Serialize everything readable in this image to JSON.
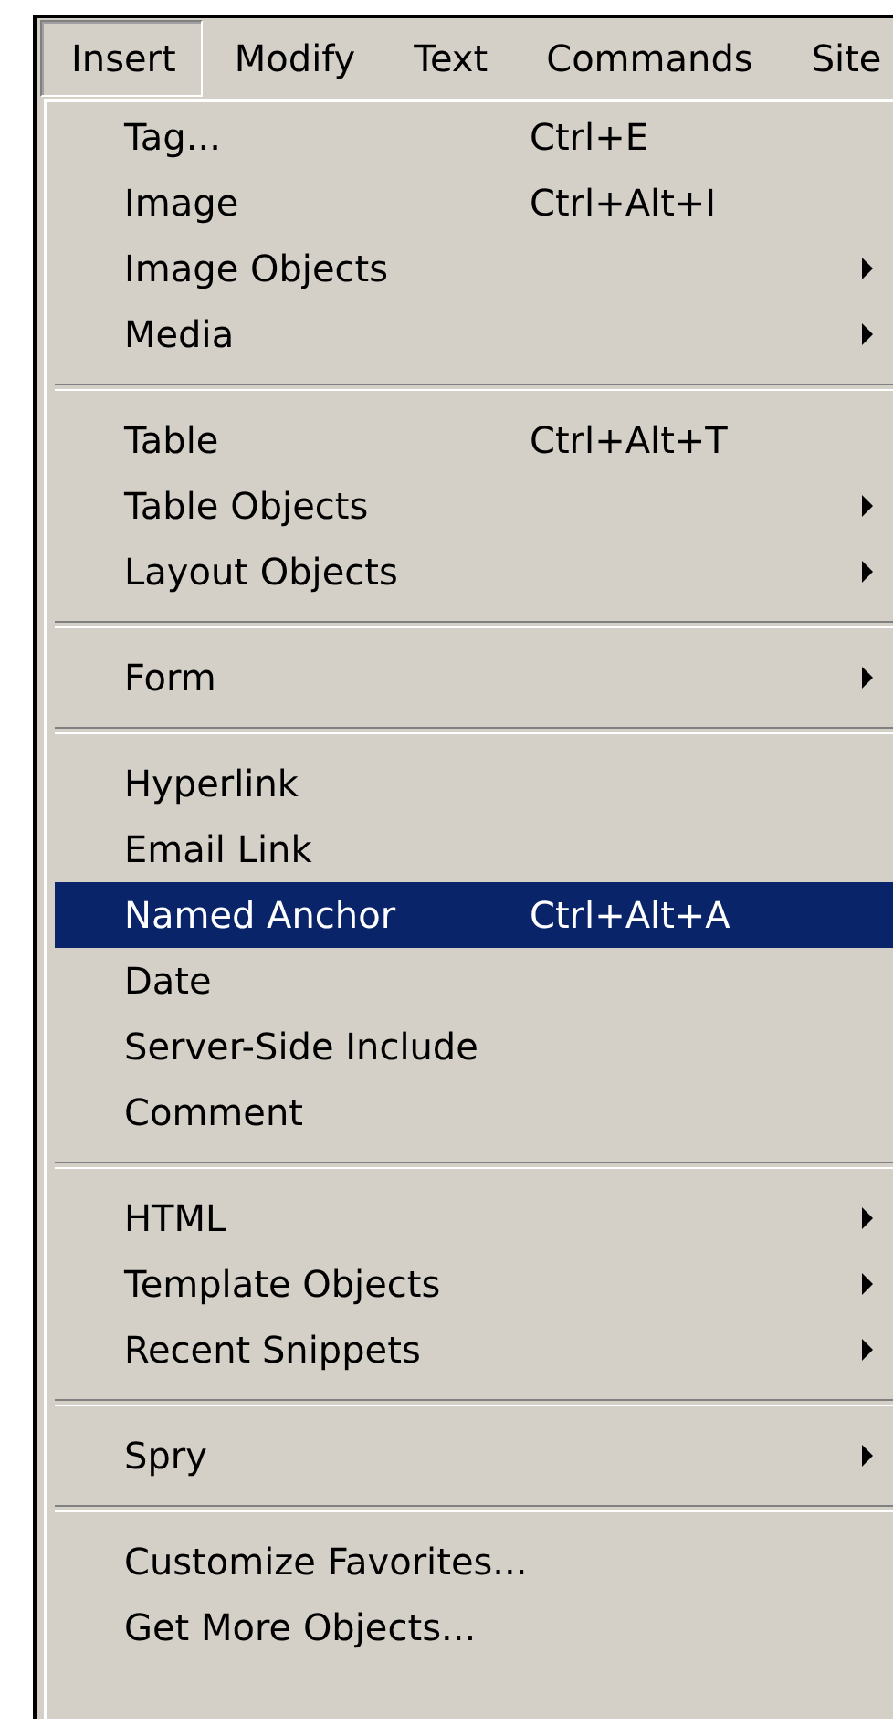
{
  "menubar": [
    {
      "label": "Insert",
      "selected": true
    },
    {
      "label": "Modify",
      "selected": false
    },
    {
      "label": "Text",
      "selected": false
    },
    {
      "label": "Commands",
      "selected": false
    },
    {
      "label": "Site",
      "selected": false
    }
  ],
  "menu": {
    "sections": [
      [
        {
          "label": "Tag...",
          "shortcut": "Ctrl+E",
          "submenu": false,
          "selected": false
        },
        {
          "label": "Image",
          "shortcut": "Ctrl+Alt+I",
          "submenu": false,
          "selected": false
        },
        {
          "label": "Image Objects",
          "submenu": true,
          "selected": false
        },
        {
          "label": "Media",
          "submenu": true,
          "selected": false
        }
      ],
      [
        {
          "label": "Table",
          "shortcut": "Ctrl+Alt+T",
          "submenu": false,
          "selected": false
        },
        {
          "label": "Table Objects",
          "submenu": true,
          "selected": false
        },
        {
          "label": "Layout Objects",
          "submenu": true,
          "selected": false
        }
      ],
      [
        {
          "label": "Form",
          "submenu": true,
          "selected": false
        }
      ],
      [
        {
          "label": "Hyperlink",
          "submenu": false,
          "selected": false
        },
        {
          "label": "Email Link",
          "submenu": false,
          "selected": false
        },
        {
          "label": "Named Anchor",
          "shortcut": "Ctrl+Alt+A",
          "submenu": false,
          "selected": true
        },
        {
          "label": "Date",
          "submenu": false,
          "selected": false
        },
        {
          "label": "Server-Side Include",
          "submenu": false,
          "selected": false
        },
        {
          "label": "Comment",
          "submenu": false,
          "selected": false
        }
      ],
      [
        {
          "label": "HTML",
          "submenu": true,
          "selected": false
        },
        {
          "label": "Template Objects",
          "submenu": true,
          "selected": false
        },
        {
          "label": "Recent Snippets",
          "submenu": true,
          "selected": false
        }
      ],
      [
        {
          "label": "Spry",
          "submenu": true,
          "selected": false
        }
      ],
      [
        {
          "label": "Customize Favorites...",
          "submenu": false,
          "selected": false
        },
        {
          "label": "Get More Objects...",
          "submenu": false,
          "selected": false
        }
      ]
    ]
  }
}
